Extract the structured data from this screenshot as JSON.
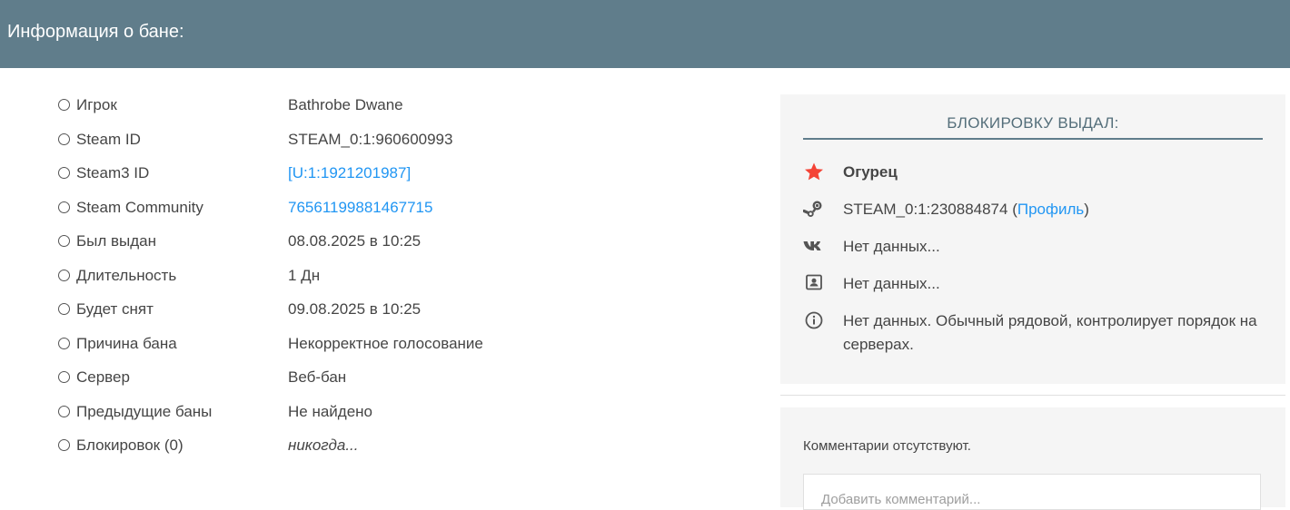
{
  "header": {
    "title": "Информация о бане:"
  },
  "info": [
    {
      "label": "Игрок",
      "value": "Bathrobe Dwane"
    },
    {
      "label": "Steam ID",
      "value": "STEAM_0:1:960600993"
    },
    {
      "label": "Steam3 ID",
      "value": "[U:1:1921201987]"
    },
    {
      "label": "Steam Community",
      "value": "76561199881467715"
    },
    {
      "label": "Был выдан",
      "value": "08.08.2025 в 10:25"
    },
    {
      "label": "Длительность",
      "value": "1 Дн"
    },
    {
      "label": "Будет снят",
      "value": "09.08.2025 в 10:25"
    },
    {
      "label": "Причина бана",
      "value": "Некорректное голосование"
    },
    {
      "label": "Сервер",
      "value": "Веб-бан"
    },
    {
      "label": "Предыдущие баны",
      "value": "Не найдено"
    },
    {
      "label": "Блокировок (0)",
      "value": "никогда..."
    }
  ],
  "admin": {
    "title": "БЛОКИРОВКУ ВЫДАЛ:",
    "name": "Огурец",
    "steam_id": "STEAM_0:1:230884874",
    "steam_open": " (",
    "profile_link": "Профиль",
    "steam_close": ")",
    "vk": "Нет данных...",
    "contact": "Нет данных...",
    "about": "Нет данных. Обычный рядовой, контролирует порядок на серверах."
  },
  "comments": {
    "empty_text": "Комментарии отсутствуют.",
    "placeholder": "Добавить комментарий..."
  },
  "icons": {
    "info_row": "circle-outline-icon",
    "admin_name": "star-icon",
    "steam": "steam-icon",
    "vk": "vk-icon",
    "contact": "contact-card-icon",
    "about": "info-icon"
  },
  "colors": {
    "header_bg": "#607d8b",
    "link": "#2196f3",
    "star": "#f44336",
    "card_bg": "#f5f5f5"
  }
}
